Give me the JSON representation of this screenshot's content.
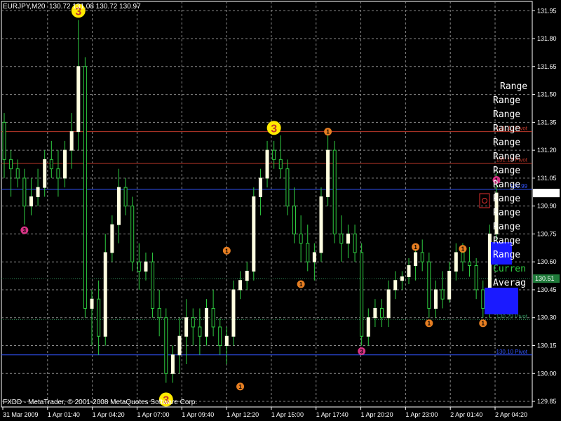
{
  "header": {
    "symbol_info": "EURJPY,M20  130.72 131.08 130.72 130.97"
  },
  "footer": {
    "copyright": "FXDD - MetaTrader, © 2001-2008 MetaQuotes Software Corp."
  },
  "colors": {
    "background": "#000000",
    "grid": "#8a8a8a",
    "bull_body": "#ffffe0",
    "bear_body": "#000000",
    "wick": "#2ecc40",
    "red_line": "#c0392b",
    "blue_line": "#3355ff",
    "green_dotted": "#2e8b57",
    "marker_yellow": "#ffea00",
    "marker_orange": "#e67e22",
    "marker_magenta": "#d63384"
  },
  "chart_data": {
    "type": "candlestick",
    "symbol": "EURJPY",
    "timeframe": "M20",
    "ylim": [
      129.82,
      132.0
    ],
    "y_ticks": [
      "131.95",
      "131.80",
      "131.65",
      "131.50",
      "131.35",
      "131.20",
      "131.05",
      "130.90",
      "130.75",
      "130.60",
      "130.45",
      "130.30",
      "130.15",
      "130.00",
      "129.85"
    ],
    "x_ticks": [
      "31 Mar 2009",
      "1 Apr 01:40",
      "1 Apr 04:20",
      "1 Apr 07:00",
      "1 Apr 09:40",
      "1 Apr 12:20",
      "1 Apr 15:00",
      "1 Apr 17:40",
      "1 Apr 20:20",
      "1 Apr 23:00",
      "2 Apr 01:40",
      "2 Apr 04:20"
    ],
    "current_price": "130.97",
    "avg_price": "130.51",
    "horizontal_lines": [
      {
        "price": 131.3,
        "color": "red"
      },
      {
        "price": 131.13,
        "color": "red"
      },
      {
        "price": 130.99,
        "color": "blue"
      },
      {
        "price": 130.51,
        "color": "green-dotted"
      },
      {
        "price": 130.29,
        "color": "green-dotted"
      },
      {
        "price": 130.1,
        "color": "blue"
      }
    ],
    "line_tags": [
      {
        "price": 131.3,
        "text": "131.30 Pivot",
        "color": "red"
      },
      {
        "price": 131.13,
        "text": "131.13 Pivot",
        "color": "red"
      },
      {
        "price": 130.99,
        "text": "130.99",
        "color": "blue"
      },
      {
        "price": 130.29,
        "text": "130.29 Pivot",
        "color": "green"
      },
      {
        "price": 130.1,
        "text": "130.10 Pivot",
        "color": "blue"
      }
    ],
    "candles": [
      {
        "o": 131.35,
        "h": 131.4,
        "l": 131.05,
        "c": 131.15
      },
      {
        "o": 131.15,
        "h": 131.2,
        "l": 130.95,
        "c": 131.1
      },
      {
        "o": 131.1,
        "h": 131.15,
        "l": 131.0,
        "c": 131.05
      },
      {
        "o": 131.05,
        "h": 131.1,
        "l": 130.8,
        "c": 130.9
      },
      {
        "o": 130.9,
        "h": 131.05,
        "l": 130.85,
        "c": 130.95
      },
      {
        "o": 130.95,
        "h": 131.1,
        "l": 130.9,
        "c": 131.0
      },
      {
        "o": 131.0,
        "h": 131.2,
        "l": 130.95,
        "c": 131.15
      },
      {
        "o": 131.15,
        "h": 131.25,
        "l": 131.05,
        "c": 131.1
      },
      {
        "o": 131.1,
        "h": 131.2,
        "l": 130.95,
        "c": 131.05
      },
      {
        "o": 131.05,
        "h": 131.25,
        "l": 131.0,
        "c": 131.2
      },
      {
        "o": 131.2,
        "h": 131.4,
        "l": 131.1,
        "c": 131.3
      },
      {
        "o": 131.3,
        "h": 131.9,
        "l": 131.2,
        "c": 131.65
      },
      {
        "o": 131.65,
        "h": 131.7,
        "l": 130.3,
        "c": 130.35
      },
      {
        "o": 130.35,
        "h": 130.45,
        "l": 130.15,
        "c": 130.4
      },
      {
        "o": 130.4,
        "h": 130.5,
        "l": 130.1,
        "c": 130.2
      },
      {
        "o": 130.2,
        "h": 130.75,
        "l": 130.15,
        "c": 130.65
      },
      {
        "o": 130.65,
        "h": 130.85,
        "l": 130.6,
        "c": 130.8
      },
      {
        "o": 130.8,
        "h": 131.1,
        "l": 130.7,
        "c": 131.0
      },
      {
        "o": 131.0,
        "h": 131.05,
        "l": 130.85,
        "c": 130.9
      },
      {
        "o": 130.9,
        "h": 130.95,
        "l": 130.55,
        "c": 130.6
      },
      {
        "o": 130.6,
        "h": 130.7,
        "l": 130.45,
        "c": 130.55
      },
      {
        "o": 130.55,
        "h": 130.65,
        "l": 130.5,
        "c": 130.6
      },
      {
        "o": 130.6,
        "h": 130.65,
        "l": 130.3,
        "c": 130.35
      },
      {
        "o": 130.35,
        "h": 130.45,
        "l": 130.2,
        "c": 130.3
      },
      {
        "o": 130.3,
        "h": 130.35,
        "l": 129.95,
        "c": 130.0
      },
      {
        "o": 130.0,
        "h": 130.15,
        "l": 129.95,
        "c": 130.1
      },
      {
        "o": 130.1,
        "h": 130.3,
        "l": 130.0,
        "c": 130.2
      },
      {
        "o": 130.2,
        "h": 130.4,
        "l": 130.05,
        "c": 130.3
      },
      {
        "o": 130.3,
        "h": 130.35,
        "l": 130.15,
        "c": 130.25
      },
      {
        "o": 130.25,
        "h": 130.35,
        "l": 130.1,
        "c": 130.2
      },
      {
        "o": 130.2,
        "h": 130.4,
        "l": 130.15,
        "c": 130.35
      },
      {
        "o": 130.35,
        "h": 130.45,
        "l": 130.2,
        "c": 130.25
      },
      {
        "o": 130.25,
        "h": 130.3,
        "l": 130.1,
        "c": 130.15
      },
      {
        "o": 130.15,
        "h": 130.25,
        "l": 130.05,
        "c": 130.2
      },
      {
        "o": 130.2,
        "h": 130.5,
        "l": 130.15,
        "c": 130.45
      },
      {
        "o": 130.45,
        "h": 130.55,
        "l": 130.4,
        "c": 130.5
      },
      {
        "o": 130.5,
        "h": 130.6,
        "l": 130.45,
        "c": 130.55
      },
      {
        "o": 130.55,
        "h": 131.0,
        "l": 130.5,
        "c": 130.95
      },
      {
        "o": 130.95,
        "h": 131.1,
        "l": 130.85,
        "c": 131.05
      },
      {
        "o": 131.05,
        "h": 131.25,
        "l": 131.0,
        "c": 131.2
      },
      {
        "o": 131.2,
        "h": 131.25,
        "l": 131.1,
        "c": 131.15
      },
      {
        "o": 131.15,
        "h": 131.28,
        "l": 131.05,
        "c": 131.1
      },
      {
        "o": 131.1,
        "h": 131.15,
        "l": 130.85,
        "c": 130.9
      },
      {
        "o": 130.9,
        "h": 131.0,
        "l": 130.7,
        "c": 130.75
      },
      {
        "o": 130.75,
        "h": 130.85,
        "l": 130.6,
        "c": 130.7
      },
      {
        "o": 130.7,
        "h": 130.8,
        "l": 130.55,
        "c": 130.6
      },
      {
        "o": 130.6,
        "h": 130.7,
        "l": 130.5,
        "c": 130.65
      },
      {
        "o": 130.65,
        "h": 131.0,
        "l": 130.6,
        "c": 130.95
      },
      {
        "o": 130.95,
        "h": 131.28,
        "l": 130.9,
        "c": 131.2
      },
      {
        "o": 131.2,
        "h": 131.25,
        "l": 130.7,
        "c": 130.75
      },
      {
        "o": 130.75,
        "h": 130.85,
        "l": 130.6,
        "c": 130.7
      },
      {
        "o": 130.7,
        "h": 130.8,
        "l": 130.62,
        "c": 130.75
      },
      {
        "o": 130.75,
        "h": 130.8,
        "l": 130.6,
        "c": 130.65
      },
      {
        "o": 130.65,
        "h": 130.7,
        "l": 130.15,
        "c": 130.2
      },
      {
        "o": 130.2,
        "h": 130.35,
        "l": 130.15,
        "c": 130.3
      },
      {
        "o": 130.3,
        "h": 130.4,
        "l": 130.25,
        "c": 130.35
      },
      {
        "o": 130.35,
        "h": 130.4,
        "l": 130.25,
        "c": 130.3
      },
      {
        "o": 130.3,
        "h": 130.5,
        "l": 130.25,
        "c": 130.45
      },
      {
        "o": 130.45,
        "h": 130.55,
        "l": 130.4,
        "c": 130.5
      },
      {
        "o": 130.5,
        "h": 130.55,
        "l": 130.45,
        "c": 130.52
      },
      {
        "o": 130.52,
        "h": 130.62,
        "l": 130.48,
        "c": 130.58
      },
      {
        "o": 130.58,
        "h": 130.7,
        "l": 130.5,
        "c": 130.65
      },
      {
        "o": 130.65,
        "h": 130.72,
        "l": 130.55,
        "c": 130.6
      },
      {
        "o": 130.6,
        "h": 130.65,
        "l": 130.3,
        "c": 130.35
      },
      {
        "o": 130.35,
        "h": 130.5,
        "l": 130.3,
        "c": 130.45
      },
      {
        "o": 130.45,
        "h": 130.55,
        "l": 130.35,
        "c": 130.4
      },
      {
        "o": 130.4,
        "h": 130.6,
        "l": 130.38,
        "c": 130.55
      },
      {
        "o": 130.55,
        "h": 130.7,
        "l": 130.5,
        "c": 130.65
      },
      {
        "o": 130.65,
        "h": 130.7,
        "l": 130.55,
        "c": 130.6
      },
      {
        "o": 130.6,
        "h": 130.68,
        "l": 130.52,
        "c": 130.58
      },
      {
        "o": 130.58,
        "h": 130.62,
        "l": 130.4,
        "c": 130.45
      },
      {
        "o": 130.45,
        "h": 130.5,
        "l": 130.3,
        "c": 130.35
      },
      {
        "o": 130.35,
        "h": 130.8,
        "l": 130.3,
        "c": 130.75
      },
      {
        "o": 130.75,
        "h": 131.08,
        "l": 130.72,
        "c": 130.97
      }
    ],
    "fractal_markers": [
      {
        "i": 11,
        "price": 131.95,
        "pos": "above",
        "color": "yellow",
        "size": "large",
        "label": "3"
      },
      {
        "i": 40,
        "price": 131.32,
        "pos": "above",
        "color": "yellow",
        "size": "large",
        "label": "3"
      },
      {
        "i": 24,
        "price": 129.86,
        "pos": "below",
        "color": "yellow",
        "size": "large",
        "label": "3"
      },
      {
        "i": 3,
        "price": 130.77,
        "pos": "below",
        "color": "magenta",
        "size": "small",
        "label": "3"
      },
      {
        "i": 48,
        "price": 131.3,
        "pos": "above",
        "color": "orange",
        "size": "small",
        "label": "1"
      },
      {
        "i": 33,
        "price": 130.66,
        "pos": "above",
        "color": "orange",
        "size": "small",
        "label": "1"
      },
      {
        "i": 44,
        "price": 130.48,
        "pos": "below",
        "color": "orange",
        "size": "small",
        "label": "1"
      },
      {
        "i": 35,
        "price": 129.93,
        "pos": "below",
        "color": "orange",
        "size": "small",
        "label": "1"
      },
      {
        "i": 53,
        "price": 130.12,
        "pos": "below",
        "color": "magenta",
        "size": "small",
        "label": "3"
      },
      {
        "i": 61,
        "price": 130.68,
        "pos": "above",
        "color": "orange",
        "size": "small",
        "label": "1"
      },
      {
        "i": 63,
        "price": 130.27,
        "pos": "below",
        "color": "orange",
        "size": "small",
        "label": "1"
      },
      {
        "i": 68,
        "price": 130.67,
        "pos": "above",
        "color": "orange",
        "size": "small",
        "label": "1"
      },
      {
        "i": 71,
        "price": 130.27,
        "pos": "below",
        "color": "orange",
        "size": "small",
        "label": "1"
      },
      {
        "i": 73,
        "price": 131.04,
        "pos": "above",
        "color": "magenta",
        "size": "small",
        "label": "1"
      }
    ],
    "range_labels": [
      {
        "text": "Range",
        "color": "#ffffff"
      },
      {
        "text": "Range",
        "color": "#ffffff"
      },
      {
        "text": "Range",
        "color": "#ffffff"
      },
      {
        "text": "Range",
        "color": "#ffffff"
      },
      {
        "text": "Range",
        "color": "#ffffff"
      },
      {
        "text": "Range",
        "color": "#ffffff"
      },
      {
        "text": "Range",
        "color": "#ffffff"
      },
      {
        "text": "Range",
        "color": "#ffffff"
      },
      {
        "text": "Range",
        "color": "#ffffff"
      },
      {
        "text": "Range",
        "color": "#ffffff"
      },
      {
        "text": "Range",
        "color": "#ffffff"
      },
      {
        "text": "Range",
        "color": "#ffffff"
      },
      {
        "text": "Range",
        "color": "#ffffff"
      },
      {
        "text": "Curren",
        "color": "#2ecc40"
      },
      {
        "text": "Averag",
        "color": "#ffffff"
      }
    ]
  }
}
